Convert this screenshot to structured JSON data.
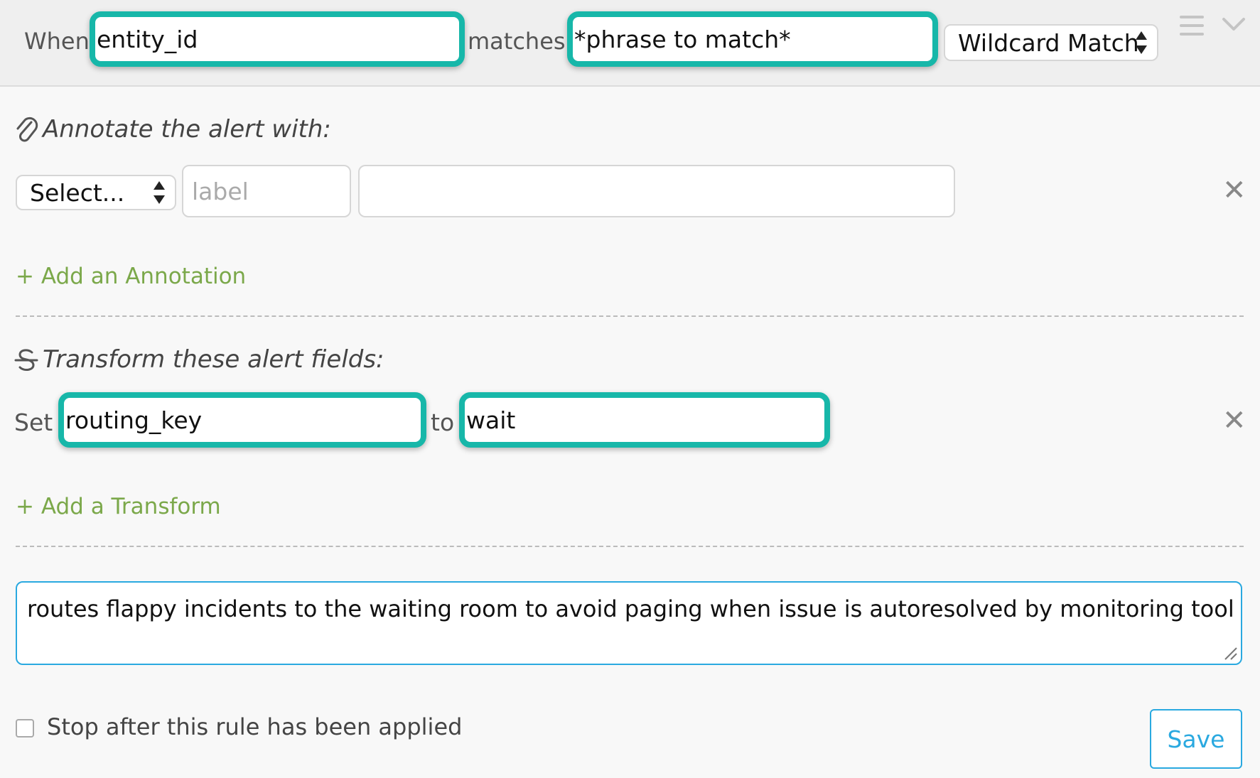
{
  "header": {
    "when_label": "When",
    "field_value": "entity_id",
    "matches_label": "matches",
    "pattern_value": "*phrase to match*",
    "match_type": "Wildcard Match",
    "menu_icon": "hamburger-icon",
    "collapse_icon": "chevron-down-icon"
  },
  "annotate": {
    "title": "Annotate the alert with:",
    "icon": "paperclip-icon",
    "select_value": "Select...",
    "label_placeholder": "label",
    "value": "",
    "remove_icon": "close-icon",
    "remove_glyph": "✕",
    "add_link": "+ Add an Annotation"
  },
  "transform": {
    "title": "Transform these alert fields:",
    "icon": "strikethrough-icon",
    "set_label": "Set",
    "field_value": "routing_key",
    "to_label": "to",
    "target_value": "wait",
    "remove_icon": "close-icon",
    "remove_glyph": "✕",
    "add_link": "+ Add a Transform"
  },
  "description": {
    "text": "routes flappy incidents to the waiting room to avoid paging when issue is autoresolved by monitoring tool"
  },
  "footer": {
    "stop_checkbox_label": "Stop after this rule has been applied",
    "stop_checked": false,
    "save_label": "Save"
  },
  "colors": {
    "highlight": "#17b7a9",
    "link_green": "#7ba84a",
    "accent_blue": "#2aa9e0"
  }
}
